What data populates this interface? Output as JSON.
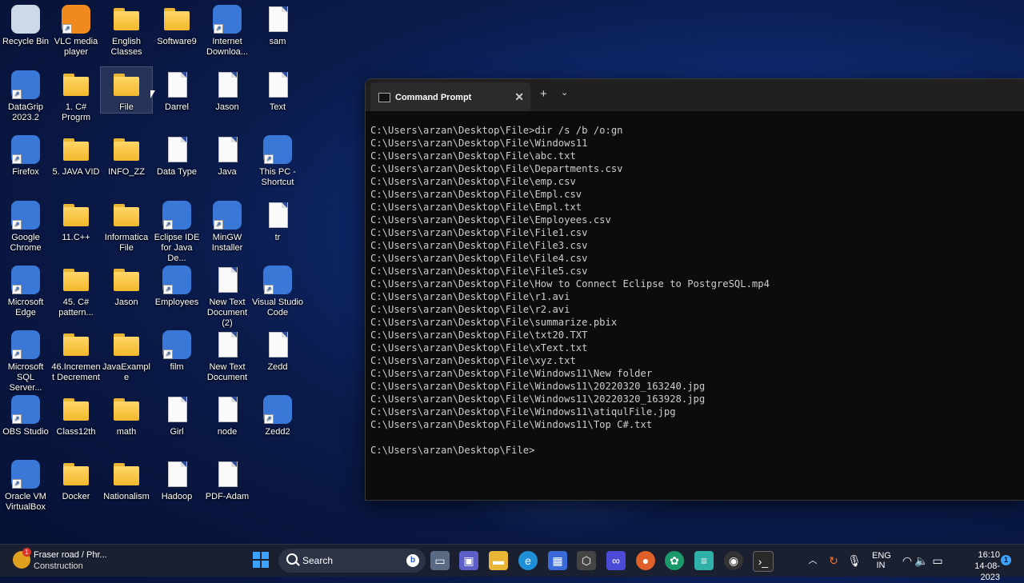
{
  "desktop": {
    "icons": [
      {
        "label": "Recycle Bin",
        "type": "recycle",
        "name": "recycle-bin-icon"
      },
      {
        "label": "VLC media player",
        "type": "vlc",
        "name": "vlc-icon"
      },
      {
        "label": "English Classes",
        "type": "folder",
        "name": "folder-icon"
      },
      {
        "label": "Software9",
        "type": "folder",
        "name": "folder-icon"
      },
      {
        "label": "Internet Downloa...",
        "type": "app",
        "name": "internet-download-manager-icon"
      },
      {
        "label": "sam",
        "type": "file",
        "name": "text-file-icon"
      },
      {
        "label": "DataGrip 2023.2",
        "type": "app",
        "name": "datagrip-icon"
      },
      {
        "label": "1. C# Progrm",
        "type": "folder",
        "name": "folder-icon"
      },
      {
        "label": "File",
        "type": "folder",
        "name": "folder-icon"
      },
      {
        "label": "Darrel",
        "type": "file",
        "name": "text-file-icon"
      },
      {
        "label": "Jason",
        "type": "file",
        "name": "text-file-icon"
      },
      {
        "label": "Text",
        "type": "file",
        "name": "text-file-icon"
      },
      {
        "label": "Firefox",
        "type": "app",
        "name": "firefox-icon"
      },
      {
        "label": "5. JAVA VID",
        "type": "folder",
        "name": "folder-icon"
      },
      {
        "label": "INFO_ZZ",
        "type": "folder",
        "name": "folder-icon"
      },
      {
        "label": "Data Type",
        "type": "file",
        "name": "text-file-icon"
      },
      {
        "label": "Java",
        "type": "file",
        "name": "text-file-icon"
      },
      {
        "label": "This PC - Shortcut",
        "type": "app",
        "name": "this-pc-icon"
      },
      {
        "label": "Google Chrome",
        "type": "app",
        "name": "chrome-icon"
      },
      {
        "label": "11.C++",
        "type": "folder",
        "name": "folder-icon"
      },
      {
        "label": "Informatica File",
        "type": "folder",
        "name": "folder-icon"
      },
      {
        "label": "Eclipse IDE for Java De...",
        "type": "app",
        "name": "eclipse-icon"
      },
      {
        "label": "MinGW Installer",
        "type": "app",
        "name": "mingw-icon"
      },
      {
        "label": "tr",
        "type": "file",
        "name": "text-file-icon"
      },
      {
        "label": "Microsoft Edge",
        "type": "app",
        "name": "edge-icon"
      },
      {
        "label": "45. C# pattern...",
        "type": "folder",
        "name": "folder-icon"
      },
      {
        "label": "Jason",
        "type": "folder",
        "name": "folder-icon"
      },
      {
        "label": "Employees",
        "type": "app",
        "name": "media-file-icon"
      },
      {
        "label": "New Text Document (2)",
        "type": "file",
        "name": "text-file-icon"
      },
      {
        "label": "Visual Studio Code",
        "type": "app",
        "name": "vscode-icon"
      },
      {
        "label": "Microsoft SQL Server...",
        "type": "app",
        "name": "sql-server-icon"
      },
      {
        "label": "46.Increment Decrement",
        "type": "folder",
        "name": "folder-icon"
      },
      {
        "label": "JavaExample",
        "type": "folder",
        "name": "folder-icon"
      },
      {
        "label": "film",
        "type": "app",
        "name": "media-file-icon"
      },
      {
        "label": "New Text Document",
        "type": "file",
        "name": "text-file-icon"
      },
      {
        "label": "Zedd",
        "type": "file",
        "name": "text-file-icon"
      },
      {
        "label": "OBS Studio",
        "type": "app",
        "name": "obs-icon"
      },
      {
        "label": "Class12th",
        "type": "folder",
        "name": "folder-icon"
      },
      {
        "label": "math",
        "type": "folder",
        "name": "folder-icon"
      },
      {
        "label": "Girl",
        "type": "file",
        "name": "text-file-icon"
      },
      {
        "label": "node",
        "type": "file",
        "name": "text-file-icon"
      },
      {
        "label": "Zedd2",
        "type": "app",
        "name": "java-file-icon"
      },
      {
        "label": "Oracle VM VirtualBox",
        "type": "app",
        "name": "virtualbox-icon"
      },
      {
        "label": "Docker",
        "type": "folder",
        "name": "folder-icon"
      },
      {
        "label": "Nationalism",
        "type": "folder",
        "name": "folder-icon"
      },
      {
        "label": "Hadoop",
        "type": "file",
        "name": "text-file-icon"
      },
      {
        "label": "PDF-Adam",
        "type": "file",
        "name": "text-file-icon"
      }
    ]
  },
  "terminal": {
    "tab_title": "Command Prompt",
    "close_glyph": "✕",
    "add_glyph": "+",
    "dropdown_glyph": "⌄",
    "lines": [
      "C:\\Users\\arzan\\Desktop\\File>dir /s /b /o:gn",
      "C:\\Users\\arzan\\Desktop\\File\\Windows11",
      "C:\\Users\\arzan\\Desktop\\File\\abc.txt",
      "C:\\Users\\arzan\\Desktop\\File\\Departments.csv",
      "C:\\Users\\arzan\\Desktop\\File\\emp.csv",
      "C:\\Users\\arzan\\Desktop\\File\\Empl.csv",
      "C:\\Users\\arzan\\Desktop\\File\\Empl.txt",
      "C:\\Users\\arzan\\Desktop\\File\\Employees.csv",
      "C:\\Users\\arzan\\Desktop\\File\\File1.csv",
      "C:\\Users\\arzan\\Desktop\\File\\File3.csv",
      "C:\\Users\\arzan\\Desktop\\File\\File4.csv",
      "C:\\Users\\arzan\\Desktop\\File\\File5.csv",
      "C:\\Users\\arzan\\Desktop\\File\\How to Connect Eclipse to PostgreSQL.mp4",
      "C:\\Users\\arzan\\Desktop\\File\\r1.avi",
      "C:\\Users\\arzan\\Desktop\\File\\r2.avi",
      "C:\\Users\\arzan\\Desktop\\File\\summarize.pbix",
      "C:\\Users\\arzan\\Desktop\\File\\txt20.TXT",
      "C:\\Users\\arzan\\Desktop\\File\\xText.txt",
      "C:\\Users\\arzan\\Desktop\\File\\xyz.txt",
      "C:\\Users\\arzan\\Desktop\\File\\Windows11\\New folder",
      "C:\\Users\\arzan\\Desktop\\File\\Windows11\\20220320_163240.jpg",
      "C:\\Users\\arzan\\Desktop\\File\\Windows11\\20220320_163928.jpg",
      "C:\\Users\\arzan\\Desktop\\File\\Windows11\\atiqulFile.jpg",
      "C:\\Users\\arzan\\Desktop\\File\\Windows11\\Top C#.txt",
      "",
      "C:\\Users\\arzan\\Desktop\\File>"
    ]
  },
  "taskbar": {
    "weather_title": "Fraser road / Phr...",
    "weather_sub": "Construction",
    "weather_badge": "1",
    "search_placeholder": "Search",
    "lang_top": "ENG",
    "lang_bottom": "IN",
    "time": "16:10",
    "date": "14-08-2023",
    "notification_count": "1"
  },
  "colors": {
    "folder": "#f3b82c",
    "accent": "#3ba3ff",
    "terminal_bg": "#0c0c0c",
    "terminal_fg": "#cccccc"
  }
}
